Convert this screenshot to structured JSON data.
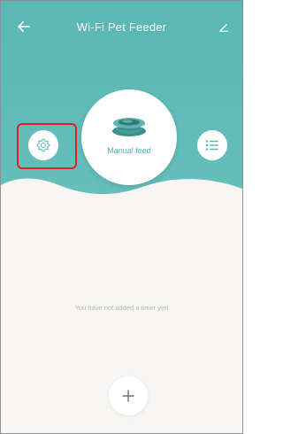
{
  "header": {
    "title": "Wi-Fi Pet Feeder",
    "back_icon": "arrow-left-icon",
    "edit_icon": "pencil-icon"
  },
  "hero": {
    "manual_feed_label": "Manual feed",
    "settings_icon": "gear-icon",
    "list_icon": "list-icon"
  },
  "timers": {
    "empty_message": "You have not added a timer yet!",
    "add_icon": "plus-icon"
  },
  "colors": {
    "teal": "#5fbab7",
    "teal_light": "#82cbc7",
    "background": "#f7f6f4",
    "highlight_red": "#e01e2b"
  }
}
